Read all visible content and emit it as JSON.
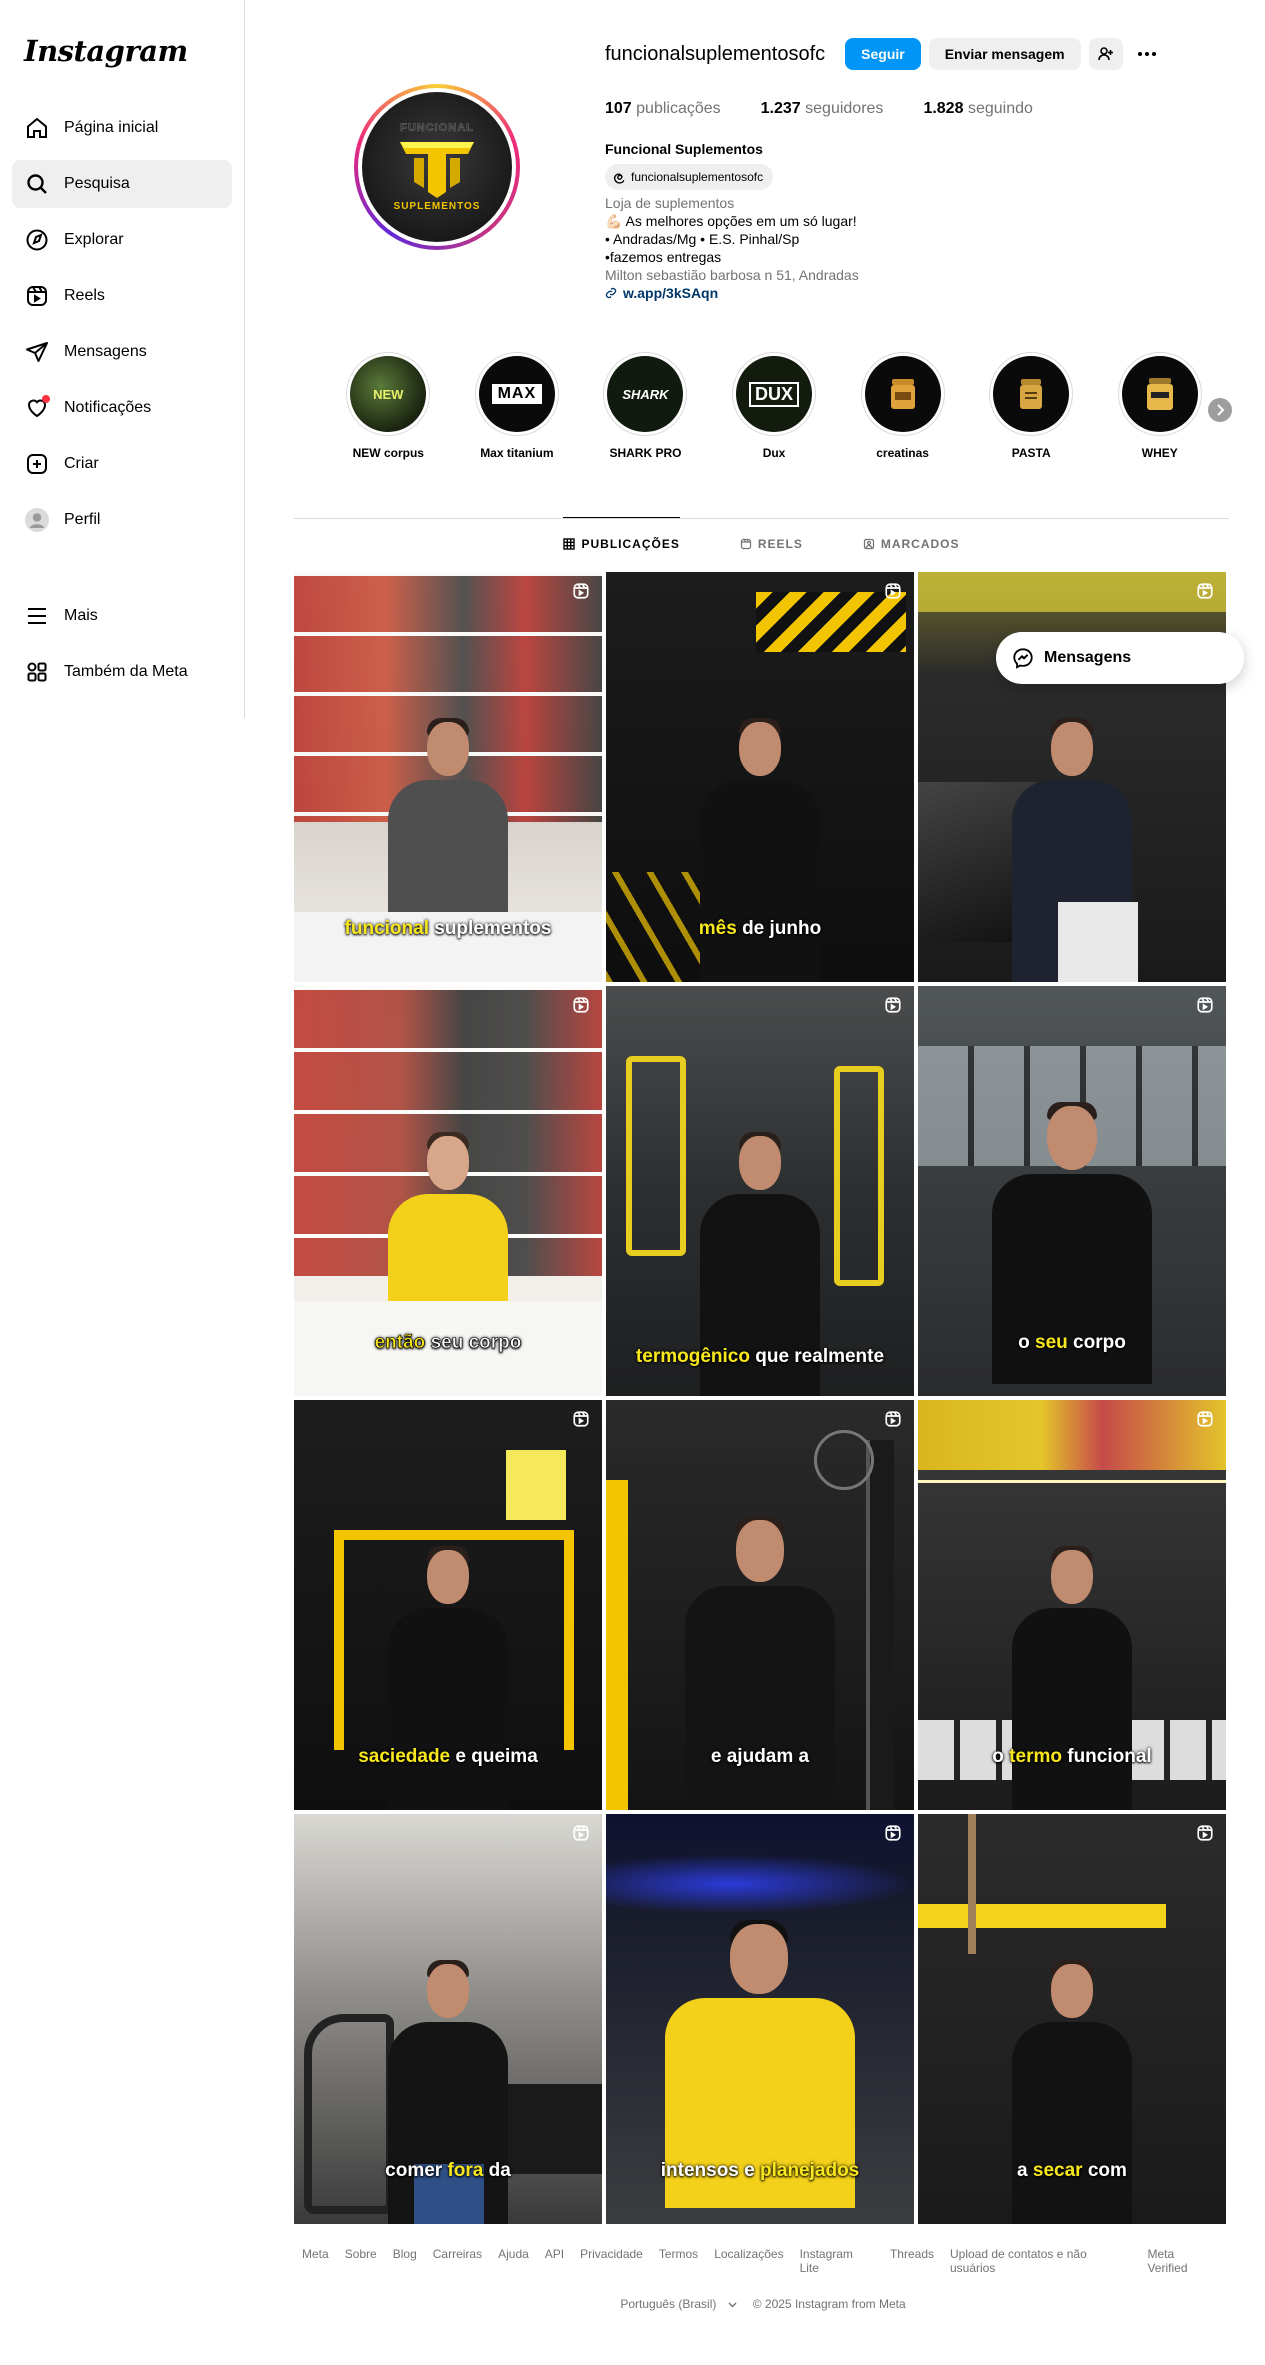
{
  "app": {
    "logo": "Instagram"
  },
  "sidebar": {
    "items": [
      {
        "label": "Página inicial",
        "icon": "home-icon"
      },
      {
        "label": "Pesquisa",
        "icon": "search-icon"
      },
      {
        "label": "Explorar",
        "icon": "compass-icon"
      },
      {
        "label": "Reels",
        "icon": "reels-icon"
      },
      {
        "label": "Mensagens",
        "icon": "send-icon"
      },
      {
        "label": "Notificações",
        "icon": "heart-icon"
      },
      {
        "label": "Criar",
        "icon": "plus-square-icon"
      },
      {
        "label": "Perfil",
        "icon": "profile-avatar-icon"
      }
    ],
    "bottom": [
      {
        "label": "Mais",
        "icon": "menu-icon"
      },
      {
        "label": "Também da Meta",
        "icon": "meta-apps-icon"
      }
    ]
  },
  "profile": {
    "username": "funcionalsuplementosofc",
    "follow_label": "Seguir",
    "message_label": "Enviar mensagem",
    "avatar_text_top": "FUNCIONAL",
    "avatar_text_bottom": "SUPLEMENTOS",
    "stats": {
      "posts_count": "107",
      "posts_label": "publicações",
      "followers_count": "1.237",
      "followers_label": "seguidores",
      "following_count": "1.828",
      "following_label": "seguindo"
    },
    "display_name": "Funcional Suplementos",
    "threads_handle": "funcionalsuplementosofc",
    "category": "Loja de suplementos",
    "bio_lines": [
      "💪🏻 As melhores opções em um só lugar!",
      "• Andradas/Mg • E.S. Pinhal/Sp",
      "•fazemos entregas"
    ],
    "address": "Milton sebastião barbosa n 51, Andradas",
    "link": "w.app/3kSAqn"
  },
  "highlights": [
    {
      "label": "NEW corpus",
      "cover": "NEW"
    },
    {
      "label": "Max titanium",
      "cover": "MAX"
    },
    {
      "label": "SHARK PRO",
      "cover": "SHARK"
    },
    {
      "label": "Dux",
      "cover": "DUX"
    },
    {
      "label": "creatinas",
      "cover": ""
    },
    {
      "label": "PASTA",
      "cover": ""
    },
    {
      "label": "WHEY",
      "cover": ""
    }
  ],
  "tabs": [
    {
      "label": "PUBLICAÇÕES",
      "icon": "grid-icon"
    },
    {
      "label": "REELS",
      "icon": "reels-icon"
    },
    {
      "label": "MARCADOS",
      "icon": "tagged-icon"
    }
  ],
  "posts": [
    {
      "caption_hi": "funcional",
      "caption_rest": " suplementos"
    },
    {
      "caption_hi": "mês",
      "caption_rest": " de junho"
    },
    {
      "caption_hi": "",
      "caption_rest": ""
    },
    {
      "caption_hi": "então",
      "caption_rest": " seu corpo"
    },
    {
      "caption_hi": "termogênico",
      "caption_rest": " que realmente"
    },
    {
      "caption_pre": "o ",
      "caption_hi": "seu",
      "caption_rest": " corpo"
    },
    {
      "caption_hi": "saciedade",
      "caption_rest": " e queima"
    },
    {
      "caption_hi": "",
      "caption_rest": "e ajudam a"
    },
    {
      "caption_pre": "o ",
      "caption_hi": "termo",
      "caption_rest": " funcional"
    },
    {
      "caption_pre": "comer ",
      "caption_hi": "fora",
      "caption_rest": " da"
    },
    {
      "caption_pre": "intensos e ",
      "caption_hi": "planejados",
      "caption_rest": ""
    },
    {
      "caption_pre": "a ",
      "caption_hi": "secar",
      "caption_rest": " com"
    }
  ],
  "floating": {
    "messages_label": "Mensagens"
  },
  "footer": {
    "links": [
      "Meta",
      "Sobre",
      "Blog",
      "Carreiras",
      "Ajuda",
      "API",
      "Privacidade",
      "Termos",
      "Localizações",
      "Instagram Lite",
      "Threads",
      "Upload de contatos e não usuários",
      "Meta Verified"
    ],
    "language": "Português (Brasil)",
    "copyright": "© 2025 Instagram from Meta"
  }
}
